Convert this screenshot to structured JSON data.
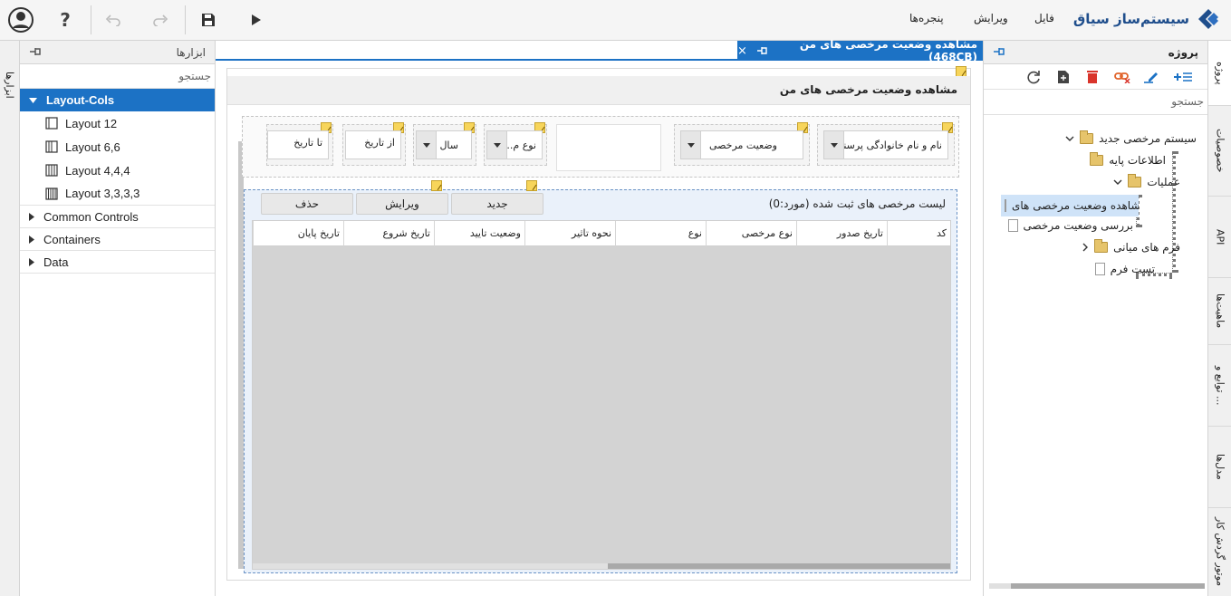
{
  "app": {
    "brand": "سیستم‌ساز سیاق",
    "menu": [
      "فایل",
      "ویرایش",
      "پنجره‌ها"
    ]
  },
  "toolbox": {
    "title": "ابزارها",
    "strip_label": "ابزارها",
    "search_placeholder": "جستجو",
    "categories": [
      {
        "label": "Layout-Cols",
        "expanded": true,
        "items": [
          "Layout 12",
          "Layout 6,6",
          "Layout 4,4,4",
          "Layout 3,3,3,3"
        ]
      },
      {
        "label": "Common Controls",
        "expanded": false
      },
      {
        "label": "Containers",
        "expanded": false
      },
      {
        "label": "Data",
        "expanded": false
      }
    ]
  },
  "document": {
    "tab_title": "مشاهده وضعیت مرخصی های من (468CB)",
    "form_title": "مشاهده وضعیت مرخصی های من",
    "filters": {
      "person": "نام و نام خانوادگی پرسنل",
      "status": "وضعیت مرخصی",
      "type": "نوع م...",
      "year": "سال",
      "from": "از تاریخ",
      "to": "تا تاریخ"
    },
    "grid": {
      "title": "لیست مرخصی های ثبت شده (مورد:0)",
      "buttons": {
        "new": "جدید",
        "edit": "ویرایش",
        "delete": "حذف"
      },
      "columns": [
        "کد",
        "تاریخ صدور",
        "نوع مرخصی",
        "نوع",
        "نحوه تاثیر",
        "وضعیت تایید",
        "تاریخ شروع",
        "تاریخ پایان"
      ]
    }
  },
  "project": {
    "title": "پروژه",
    "search_placeholder": "جستجو",
    "tree": {
      "root": "سیستم مرخصی جدید",
      "base": "اطلاعات پایه",
      "ops": "عملیات",
      "op1": "مشاهده وضعیت مرخصی های",
      "op2": "بررسی وضعیت مرخصی",
      "mid": "فرم های میانی",
      "test": "تست فرم"
    },
    "side_tabs": [
      "پروژه",
      "خصوصیات",
      "API",
      "ماهیت‌ها",
      "توابع و ...",
      "مدل‌ها",
      "موتور گردش کار"
    ]
  },
  "colors": {
    "accent": "#1c72c5",
    "brand": "#1f4e8c"
  }
}
